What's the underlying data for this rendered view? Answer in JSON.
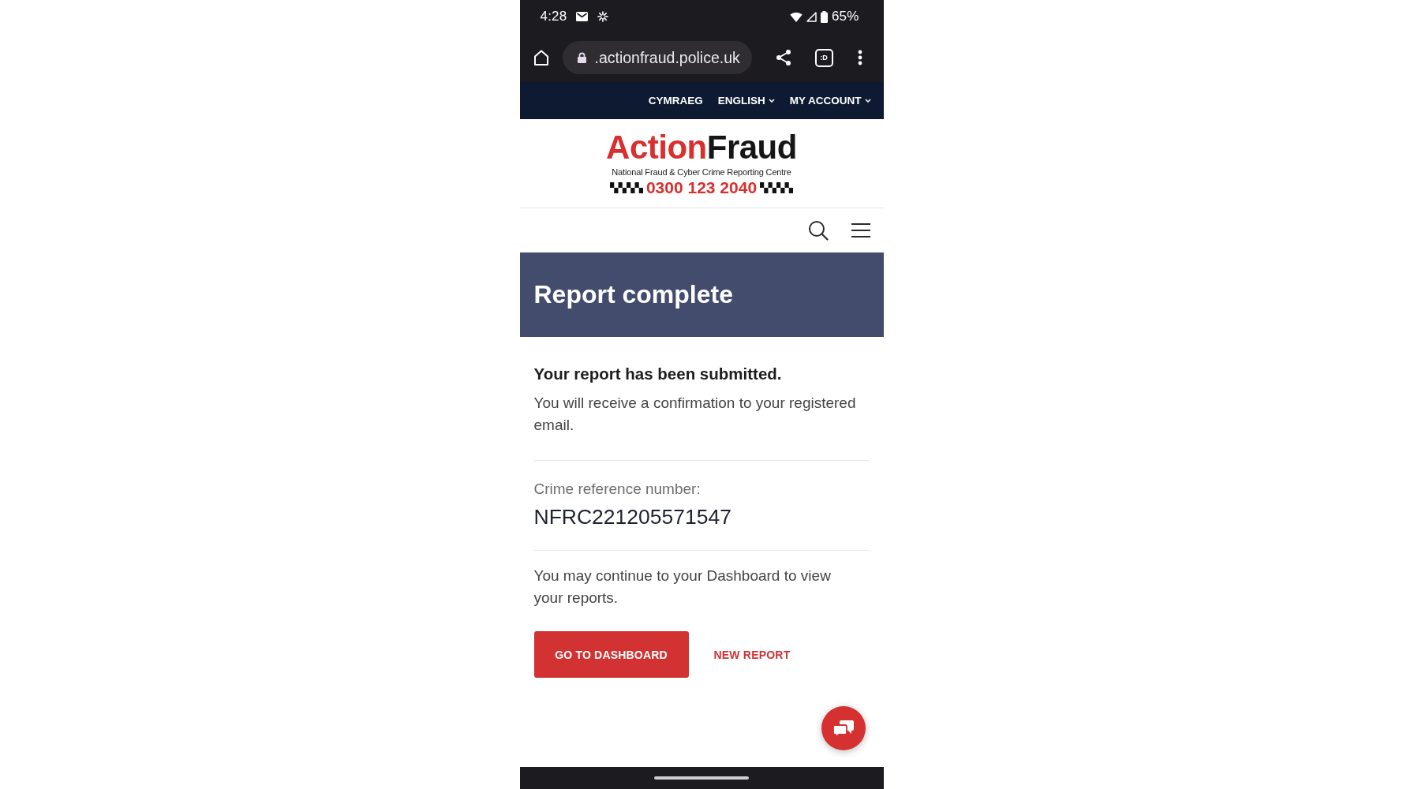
{
  "status_bar": {
    "time": "4:28",
    "battery": "65%"
  },
  "browser_toolbar": {
    "url": ".actionfraud.police.uk",
    "tab_count": ":D"
  },
  "top_nav": {
    "items": [
      {
        "label": "CYMRAEG",
        "dropdown": false
      },
      {
        "label": "ENGLISH",
        "dropdown": true
      },
      {
        "label": "MY ACCOUNT",
        "dropdown": true
      }
    ]
  },
  "logo": {
    "wordmark_first": "Action",
    "wordmark_second": "Fraud",
    "tagline": "National Fraud & Cyber Crime Reporting Centre",
    "phone": "0300 123 2040"
  },
  "banner": {
    "title": "Report complete"
  },
  "confirmation": {
    "heading": "Your report has been submitted.",
    "message": "You will receive a confirmation to your registered email."
  },
  "reference": {
    "label": "Crime reference number:",
    "value": "NFRC221205571547"
  },
  "next_steps": {
    "message": "You may continue to your Dashboard to view your reports."
  },
  "actions": [
    {
      "label": "GO TO DASHBOARD",
      "kind": "primary"
    },
    {
      "label": "NEW REPORT",
      "kind": "link"
    }
  ]
}
